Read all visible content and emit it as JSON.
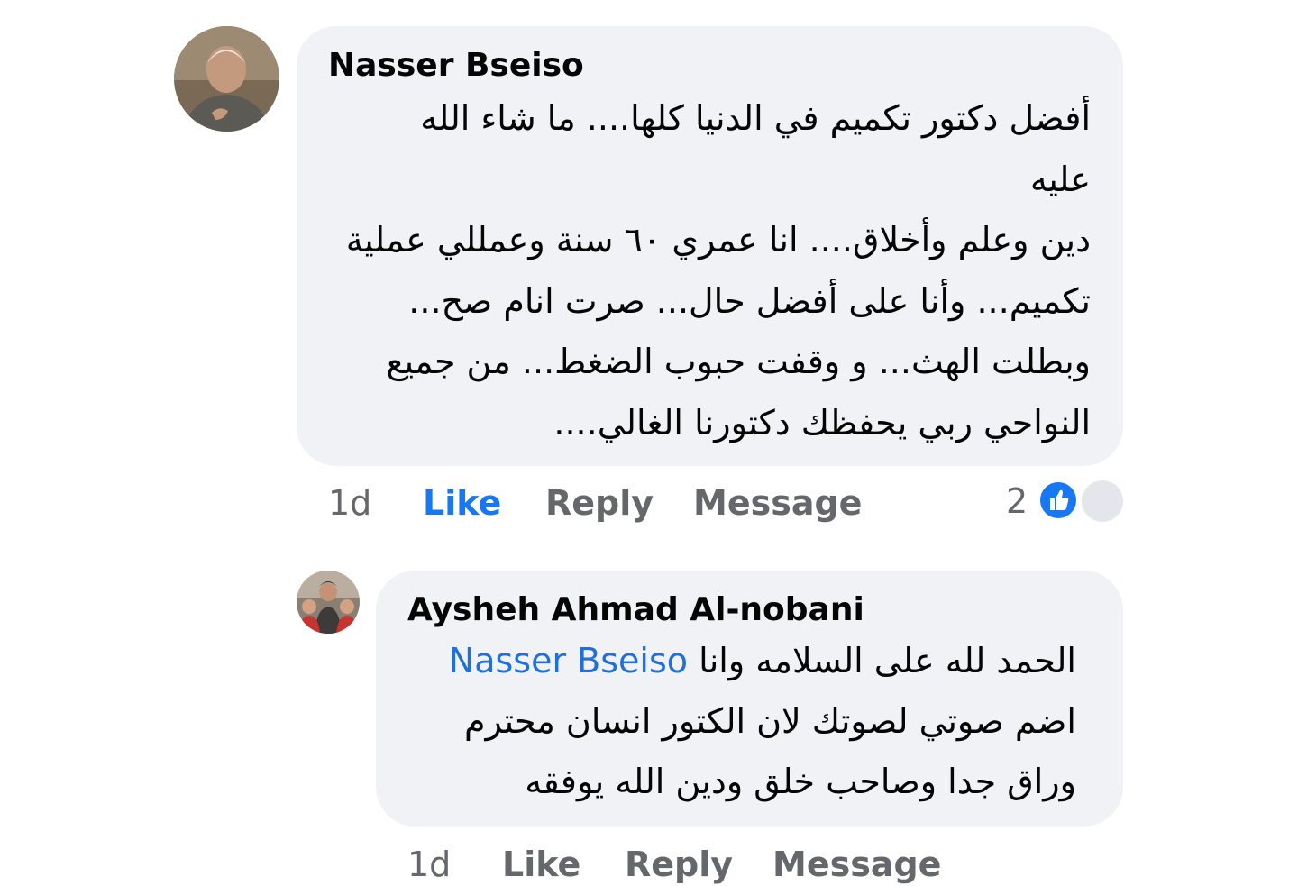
{
  "comments": [
    {
      "author": "Nasser Bseiso",
      "text_lines": [
        "أفضل دكتور تكميم في الدنيا كلها.... ما شاء الله",
        "عليه",
        "دين وعلم وأخلاق.... انا عمري ٦٠ سنة وعمللي عملية",
        "تكميم... وأنا على أفضل حال... صرت انام صح...",
        "وبطلت الهث... و وقفت حبوب الضغط... من جميع",
        "النواحي ربي يحفظك دكتورنا الغالي...."
      ],
      "time": "1d",
      "like_label": "Like",
      "reply_label": "Reply",
      "message_label": "Message",
      "reaction_count": "2",
      "liked": true
    },
    {
      "author": "Aysheh Ahmad Al-nobani",
      "mention": "Nasser Bseiso",
      "text_line1": "الحمد لله على السلامه وانا",
      "text_lines": [
        "اضم صوتي لصوتك لان الكتور انسان محترم",
        "وراق جدا وصاحب خلق ودين الله يوفقه"
      ],
      "time": "1d",
      "like_label": "Like",
      "reply_label": "Reply",
      "message_label": "Message"
    }
  ],
  "colors": {
    "bubble": "#f0f2f5",
    "link": "#216fdb",
    "like_active": "#1877f2",
    "meta": "#65676b"
  },
  "icons": [
    "thumbs-up-icon"
  ]
}
